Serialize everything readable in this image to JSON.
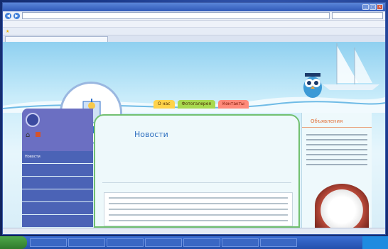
{
  "colors": {
    "title_blue": "#2d6fbf",
    "menu_blue": "#4b63b6",
    "nav_yellow": "#ffd34a",
    "nav_green": "#a8d94f",
    "nav_red": "#ff8a7a",
    "right_header": "#e2723a",
    "panel_border": "#72c070"
  },
  "browser": {
    "title": "",
    "address": "",
    "tab": "",
    "menu": [
      "",
      "",
      "",
      "",
      ""
    ],
    "favorites": [
      "",
      "",
      "",
      ""
    ],
    "tab_tools": [
      "",
      "",
      ""
    ]
  },
  "site": {
    "logo_name": "",
    "top_nav": [
      "О нас",
      "Фотогалерея",
      "Контакты"
    ],
    "left_menu": [
      "Новости",
      "",
      "",
      "",
      "",
      ""
    ],
    "main": {
      "title": "Новости",
      "subtitle": "",
      "field_label": "",
      "file_value": "",
      "link": "",
      "date": "",
      "footer": ""
    },
    "right": {
      "header": "Объявления"
    }
  },
  "status": "",
  "taskbar": {
    "start": "",
    "tasks": [
      "",
      "",
      "",
      "",
      "",
      "",
      ""
    ],
    "clock": ""
  }
}
